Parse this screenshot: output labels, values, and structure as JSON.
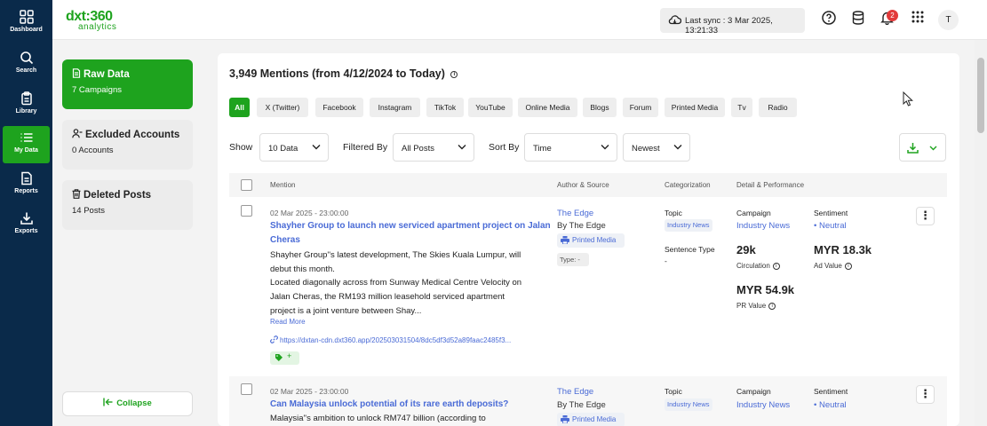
{
  "nav": {
    "items": [
      {
        "label": "Dashboard",
        "icon": "grid-icon"
      },
      {
        "label": "Search",
        "icon": "search-icon"
      },
      {
        "label": "Library",
        "icon": "clipboard-icon"
      },
      {
        "label": "My Data",
        "icon": "list-icon",
        "active": true
      },
      {
        "label": "Reports",
        "icon": "report-icon"
      },
      {
        "label": "Exports",
        "icon": "export-icon"
      }
    ]
  },
  "brand": {
    "logo": "dxt:360",
    "sub": "analytics",
    "color": "#1ea31e"
  },
  "header": {
    "sync_text": "Last sync : 3 Mar 2025, 13:21:33",
    "notification_count": "2",
    "avatar_initial": "T"
  },
  "sidebar": {
    "raw": {
      "title": "Raw Data",
      "sub": "7 Campaigns"
    },
    "excluded": {
      "title": "Excluded Accounts",
      "sub": "0 Accounts"
    },
    "deleted": {
      "title": "Deleted Posts",
      "sub": "14 Posts"
    },
    "collapse_label": "Collapse"
  },
  "main": {
    "heading": "3,949 Mentions (from 4/12/2024 to Today)",
    "tabs": [
      "All",
      "X (Twitter)",
      "Facebook",
      "Instagram",
      "TikTok",
      "YouTube",
      "Online Media",
      "Blogs",
      "Forum",
      "Printed Media",
      "Tv",
      "Radio"
    ],
    "active_tab": "All",
    "show_label": "Show",
    "show_value": "10 Data",
    "filter_label": "Filtered By",
    "filter_value": "All Posts",
    "sort_label": "Sort By",
    "sort_value": "Time",
    "order_value": "Newest",
    "columns": {
      "mention": "Mention",
      "author": "Author & Source",
      "categorization": "Categorization",
      "detail": "Detail & Performance"
    }
  },
  "rows": [
    {
      "date": "02 Mar 2025 - 23:00:00",
      "title_line1": "Shayher Group to launch new serviced apartment project on Jalan",
      "title_line2": "Cheras",
      "body_lines": [
        "Shayher Group''s latest development, The Skies Kuala Lumpur, will",
        "debut this month.",
        "Located diagonally across from Sunway Medical Centre Velocity on",
        "Jalan Cheras, the RM193 million leasehold serviced apartment",
        "project is a joint venture between Shay..."
      ],
      "read_more": "Read More",
      "link": "https://dxtan-cdn.dxt360.app/202503031504/8dc5df3d52a89faac2485f3...",
      "tag_label": "+",
      "author": "The Edge",
      "by": "By The Edge",
      "source": "Printed Media",
      "type": "Type: -",
      "topic_label": "Topic",
      "topic": "Industry News",
      "sentence_type_label": "Sentence Type",
      "sentence_type": "-",
      "campaign_label": "Campaign",
      "campaign": "Industry News",
      "sentiment_label": "Sentiment",
      "sentiment": "Neutral",
      "circulation": "29k",
      "circulation_label": "Circulation",
      "ad_value": "MYR 18.3k",
      "ad_value_label": "Ad Value",
      "pr_value": "MYR 54.9k",
      "pr_value_label": "PR Value"
    },
    {
      "date": "02 Mar 2025 - 23:00:00",
      "title_line1": "Can Malaysia unlock potential of its rare earth deposits?",
      "body_line1": "Malaysia''s ambition to unlock RM747 billion (according to",
      "author": "The Edge",
      "by": "By The Edge",
      "source": "Printed Media",
      "topic_label": "Topic",
      "topic": "Industry News",
      "campaign_label": "Campaign",
      "campaign": "Industry News",
      "sentiment_label": "Sentiment",
      "sentiment": "Neutral"
    }
  ]
}
